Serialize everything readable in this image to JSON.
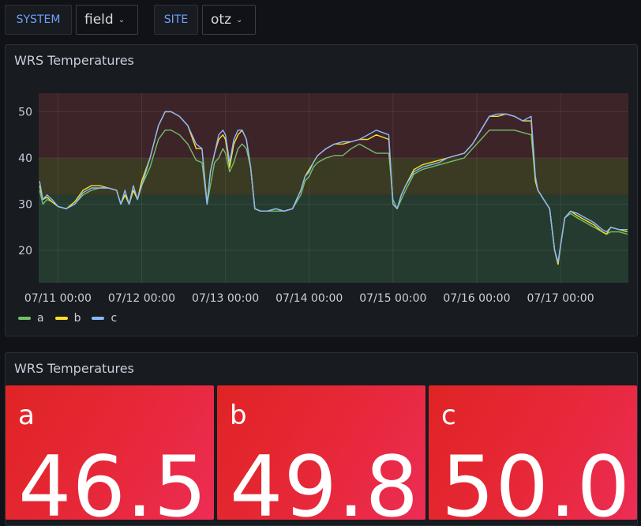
{
  "variables": [
    {
      "label": "SYSTEM",
      "value": "field"
    },
    {
      "label": "SITE",
      "value": "otz"
    }
  ],
  "chart_panel": {
    "title": "WRS Temperatures"
  },
  "stat_panel": {
    "title": "WRS Temperatures",
    "stats": [
      {
        "name": "a",
        "value": "46.5"
      },
      {
        "name": "b",
        "value": "49.8"
      },
      {
        "name": "c",
        "value": "50.0"
      }
    ]
  },
  "colors": {
    "a": "#73bf69",
    "b": "#fade2a",
    "c": "#8ab8ff",
    "threshold_green": "#263b2f",
    "threshold_yellow": "#3b3a22",
    "threshold_red": "#3d2428",
    "stat_bg": "#e02424"
  },
  "chart_data": {
    "type": "line",
    "title": "WRS Temperatures",
    "xlabel": "",
    "ylabel": "",
    "x_ticks": [
      "07/11 00:00",
      "07/12 00:00",
      "07/13 00:00",
      "07/14 00:00",
      "07/15 00:00",
      "07/16 00:00",
      "07/17 00:00"
    ],
    "y_ticks": [
      20,
      30,
      40,
      50
    ],
    "xlim_days": [
      10.77,
      17.81
    ],
    "ylim": [
      13,
      54
    ],
    "thresholds": [
      {
        "from": 13,
        "to": 32,
        "color": "green"
      },
      {
        "from": 32,
        "to": 40,
        "color": "yellow"
      },
      {
        "from": 40,
        "to": 54,
        "color": "red"
      }
    ],
    "legend_position": "bottom-left",
    "grid": true,
    "x": [
      10.78,
      10.82,
      10.87,
      10.93,
      11.0,
      11.1,
      11.2,
      11.3,
      11.4,
      11.5,
      11.6,
      11.7,
      11.75,
      11.8,
      11.85,
      11.9,
      11.95,
      12.0,
      12.1,
      12.2,
      12.28,
      12.35,
      12.45,
      12.55,
      12.65,
      12.72,
      12.78,
      12.82,
      12.87,
      12.92,
      12.97,
      13.0,
      13.05,
      13.1,
      13.15,
      13.2,
      13.25,
      13.3,
      13.35,
      13.42,
      13.5,
      13.6,
      13.7,
      13.8,
      13.9,
      13.95,
      14.0,
      14.05,
      14.1,
      14.2,
      14.3,
      14.4,
      14.5,
      14.6,
      14.7,
      14.8,
      14.95,
      15.0,
      15.05,
      15.1,
      15.15,
      15.25,
      15.35,
      15.45,
      15.55,
      15.65,
      15.75,
      15.85,
      15.95,
      16.05,
      16.15,
      16.25,
      16.35,
      16.45,
      16.55,
      16.65,
      16.7,
      16.73,
      16.8,
      16.87,
      16.93,
      16.97,
      17.0,
      17.05,
      17.12,
      17.2,
      17.3,
      17.4,
      17.5,
      17.55,
      17.6,
      17.7,
      17.8
    ],
    "series": [
      {
        "name": "a",
        "values": [
          33,
          30,
          31,
          30.5,
          29.5,
          29,
          30,
          32,
          33,
          33.5,
          33.5,
          33,
          30,
          32,
          30,
          33,
          31,
          34,
          38,
          44,
          46,
          46,
          45,
          43,
          39.5,
          39,
          30,
          34,
          39,
          40,
          42,
          41,
          37,
          39,
          42,
          43,
          42,
          38,
          29,
          28.5,
          28.5,
          28.5,
          28.5,
          29,
          32,
          35,
          36,
          38,
          39,
          40,
          40.5,
          40.5,
          42,
          43,
          42,
          41,
          41,
          31,
          29,
          31,
          33,
          36.5,
          37.5,
          38,
          38.5,
          39,
          39.5,
          40,
          42,
          44,
          46,
          46,
          46,
          46,
          45.5,
          45,
          35,
          33,
          31,
          29,
          20,
          17,
          21,
          27,
          28,
          27,
          26,
          25,
          24,
          23.5,
          24,
          24,
          23.5
        ]
      },
      {
        "name": "b",
        "values": [
          34,
          31,
          31.5,
          30.5,
          29.5,
          29,
          30.5,
          33,
          34,
          34,
          33.5,
          33,
          30,
          32,
          30,
          33,
          31,
          35,
          40,
          47,
          50,
          50,
          49,
          47,
          42,
          42,
          30,
          37,
          41,
          44,
          45,
          44,
          38,
          43,
          45,
          46,
          44,
          38,
          29,
          28.5,
          28.5,
          29,
          28.5,
          29,
          33,
          36,
          37.5,
          39,
          40.5,
          42,
          43,
          43,
          43.5,
          44,
          44,
          45,
          44,
          30,
          29,
          32,
          34,
          37.5,
          38.5,
          39,
          39.5,
          40,
          40.5,
          41,
          43,
          46,
          49,
          49,
          49.5,
          49,
          48,
          48,
          35,
          33,
          31,
          29,
          20,
          17,
          21,
          27,
          28.5,
          27.5,
          26.5,
          25.5,
          24,
          23.5,
          25,
          24.5,
          24
        ]
      },
      {
        "name": "c",
        "values": [
          35,
          31,
          32,
          31,
          29.5,
          29,
          30,
          32.5,
          33.5,
          33.5,
          33.5,
          33,
          30,
          33,
          30,
          34,
          31,
          34,
          40,
          47,
          50,
          50,
          49,
          47,
          43,
          42,
          30,
          37,
          41,
          45,
          46,
          45,
          39,
          44,
          46,
          46,
          44,
          38,
          29,
          28.5,
          28.5,
          29,
          28.5,
          29,
          33,
          36,
          37,
          39,
          40.5,
          42,
          43,
          43.5,
          43.5,
          44,
          45,
          46,
          45,
          30,
          29,
          32,
          34,
          37,
          38,
          38.5,
          39,
          40,
          40.5,
          41,
          43,
          46,
          49,
          49.5,
          49.5,
          49,
          48,
          49,
          36,
          33,
          31,
          29,
          20,
          17.5,
          21,
          27,
          28.5,
          28,
          27,
          26,
          24.5,
          24,
          25,
          24.5,
          24.5
        ]
      }
    ]
  }
}
